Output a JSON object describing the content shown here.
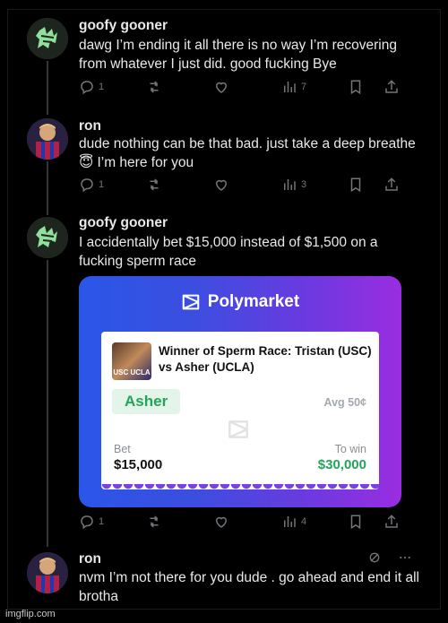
{
  "posts": [
    {
      "author": "goofy gooner",
      "text": "dawg I’m ending it all there is no way I’m recovering from whatever I just did. good fucking Bye",
      "replies": "1",
      "views": "7"
    },
    {
      "author": "ron",
      "text": "dude nothing can be that bad. just take a deep breathe 😇 I’m here for you",
      "replies": "1",
      "views": "3"
    },
    {
      "author": "goofy gooner",
      "text": "I accidentally bet $15,000 instead of $1,500 on a fucking sperm race",
      "replies": "1",
      "views": "4"
    },
    {
      "author": "ron",
      "text": "nvm I’m not there for you dude . go ahead and end it all brotha"
    }
  ],
  "card": {
    "brand": "Polymarket",
    "market_title": "Winner of Sperm Race: Tristan (USC) vs Asher (UCLA)",
    "image_caption": "USC UCLA",
    "choice": "Asher",
    "avg_label": "Avg 50¢",
    "bet_label": "Bet",
    "bet_amount": "$15,000",
    "win_label": "To win",
    "win_amount": "$30,000"
  },
  "colors": {
    "accent_green": "#23a45a",
    "card_blue": "#2a56e8",
    "card_purple": "#9a2de0",
    "muted": "#71767b"
  },
  "watermark": "imgflip.com"
}
